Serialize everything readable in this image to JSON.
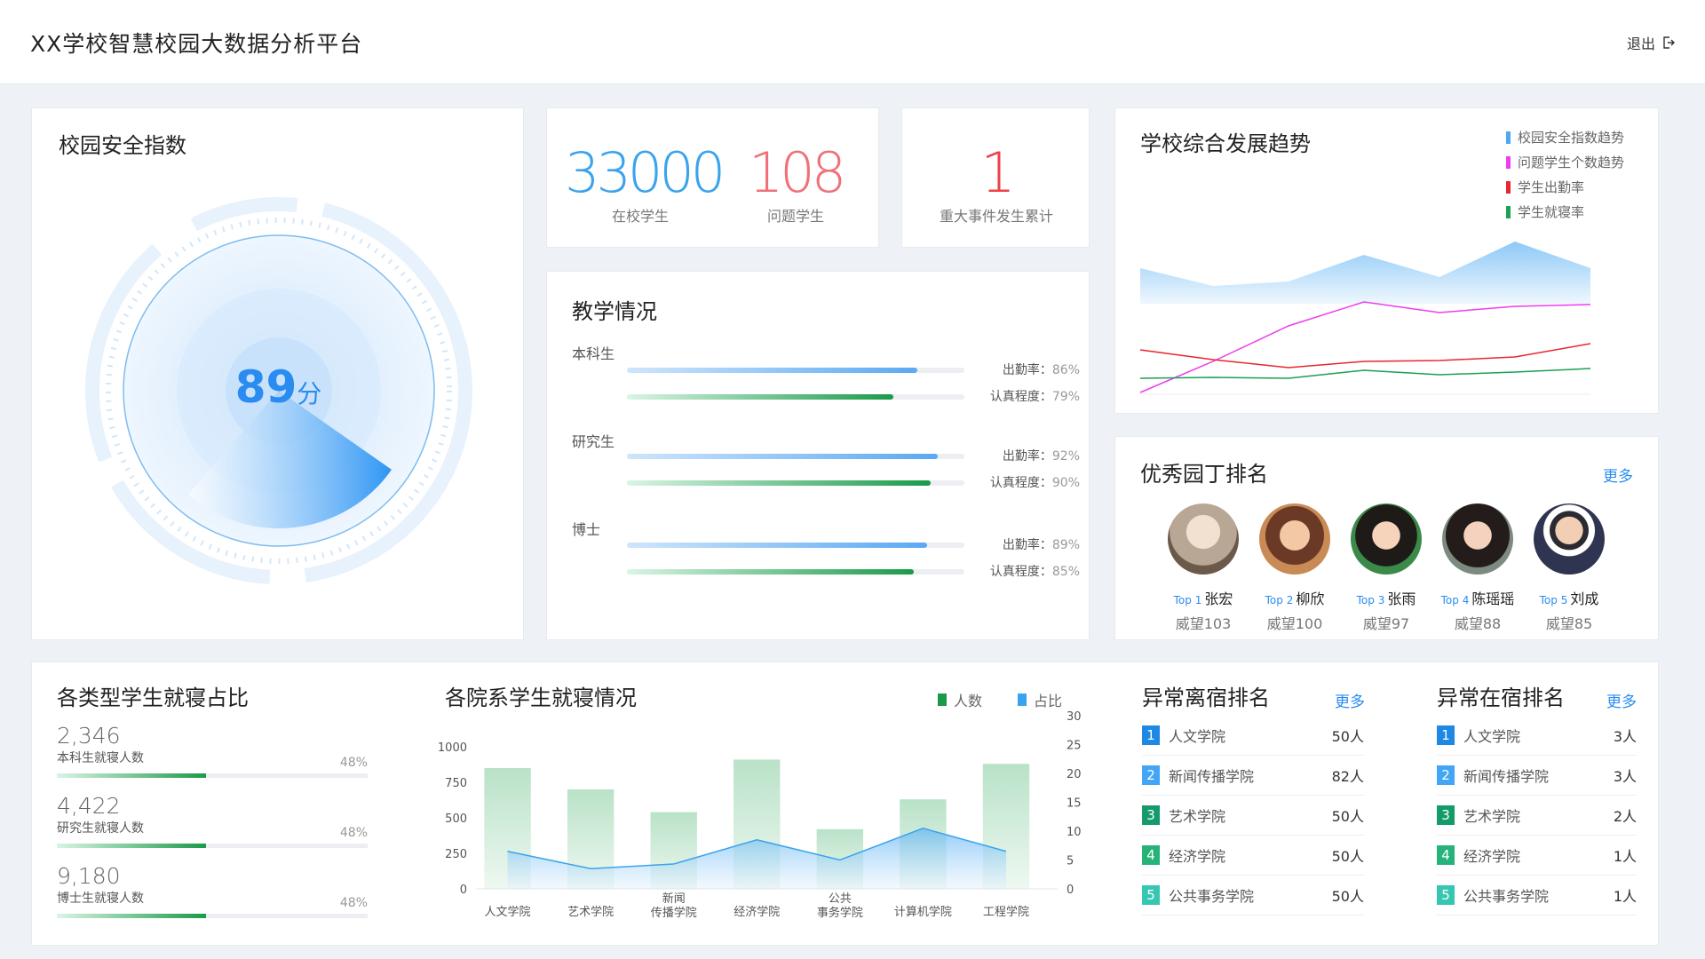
{
  "app": {
    "title": "XX学校智慧校园大数据分析平台",
    "logout_label": "退出"
  },
  "safety": {
    "title": "校园安全指数",
    "score": "89",
    "unit": "分",
    "value": 89
  },
  "stats": {
    "students": {
      "value": "33000",
      "label": "在校学生",
      "color": "#3aa3ee"
    },
    "problem": {
      "value": "108",
      "label": "问题学生",
      "color": "#f07078"
    },
    "events": {
      "value": "1",
      "label": "重大事件发生累计",
      "color": "#f0404a"
    }
  },
  "teaching": {
    "title": "教学情况",
    "groups": [
      {
        "name": "本科生",
        "attendance_label": "出勤率：",
        "attendance": "86%",
        "attendance_value": 0.86,
        "focus_label": "认真程度：",
        "focus": "79%",
        "focus_value": 0.79
      },
      {
        "name": "研究生",
        "attendance_label": "出勤率：",
        "attendance": "92%",
        "attendance_value": 0.92,
        "focus_label": "认真程度：",
        "focus": "90%",
        "focus_value": 0.9
      },
      {
        "name": "博士",
        "attendance_label": "出勤率：",
        "attendance": "89%",
        "attendance_value": 0.89,
        "focus_label": "认真程度：",
        "focus": "85%",
        "focus_value": 0.85
      }
    ]
  },
  "trend": {
    "title": "学校综合发展趋势",
    "legend": [
      {
        "name": "校园安全指数趋势",
        "color": "#4aa8f5"
      },
      {
        "name": "问题学生个数趋势",
        "color": "#ee3cf0"
      },
      {
        "name": "学生出勤率",
        "color": "#e8262f"
      },
      {
        "name": "学生就寝率",
        "color": "#1aa152"
      }
    ]
  },
  "ranking": {
    "title": "优秀园丁排名",
    "more_label": "更多",
    "teachers": [
      {
        "top": "Top 1",
        "name": "张宏",
        "score": "威望103"
      },
      {
        "top": "Top 2",
        "name": "柳欣",
        "score": "威望100"
      },
      {
        "top": "Top 3",
        "name": "张雨",
        "score": "威望97"
      },
      {
        "top": "Top 4",
        "name": "陈瑶瑶",
        "score": "威望88"
      },
      {
        "top": "Top 5",
        "name": "刘成",
        "score": "威望85"
      }
    ]
  },
  "sleep_ratio": {
    "title": "各类型学生就寝占比",
    "items": [
      {
        "value": "2,346",
        "label": "本科生就寝人数",
        "pct": "48%",
        "fill": 0.48
      },
      {
        "value": "4,422",
        "label": "研究生就寝人数",
        "pct": "48%",
        "fill": 0.48
      },
      {
        "value": "9,180",
        "label": "博士生就寝人数",
        "pct": "48%",
        "fill": 0.48
      }
    ]
  },
  "chart_data": {
    "type": "bar",
    "title": "各院系学生就寝情况",
    "categories": [
      "人文学院",
      "艺术学院",
      "新闻传播学院",
      "经济学院",
      "公共事务学院",
      "计算机学院",
      "工程学院"
    ],
    "category_lines": [
      [
        "人文学院"
      ],
      [
        "艺术学院"
      ],
      [
        "新闻",
        "传播学院"
      ],
      [
        "经济学院"
      ],
      [
        "公共",
        "事务学院"
      ],
      [
        "计算机学院"
      ],
      [
        "工程学院"
      ]
    ],
    "series": [
      {
        "name": "人数",
        "type": "bar",
        "axis": "left",
        "color": "#1a9a49",
        "values": [
          850,
          700,
          540,
          910,
          420,
          630,
          880
        ]
      },
      {
        "name": "占比",
        "type": "area",
        "axis": "right",
        "color": "#3aa3ee",
        "values": [
          6.5,
          3.5,
          4.3,
          8.5,
          5.0,
          10.5,
          6.5
        ]
      }
    ],
    "y_left": {
      "ticks": [
        "0",
        "250",
        "500",
        "750",
        "1000"
      ],
      "range": [
        0,
        1000
      ]
    },
    "y_right": {
      "ticks": [
        "0",
        "5",
        "10",
        "15",
        "20",
        "25",
        "30"
      ],
      "range": [
        0,
        30
      ]
    }
  },
  "away_list": {
    "title": "异常离宿排名",
    "more_label": "更多",
    "rows": [
      {
        "rank": "1",
        "name": "人文学院",
        "value": "50人",
        "color": "#1e88e5"
      },
      {
        "rank": "2",
        "name": "新闻传播学院",
        "value": "82人",
        "color": "#42a5f5"
      },
      {
        "rank": "3",
        "name": "艺术学院",
        "value": "50人",
        "color": "#159b6a"
      },
      {
        "rank": "4",
        "name": "经济学院",
        "value": "50人",
        "color": "#26b37a"
      },
      {
        "rank": "5",
        "name": "公共事务学院",
        "value": "50人",
        "color": "#36c7b2"
      }
    ]
  },
  "stay_list": {
    "title": "异常在宿排名",
    "more_label": "更多",
    "rows": [
      {
        "rank": "1",
        "name": "人文学院",
        "value": "3人",
        "color": "#1e88e5"
      },
      {
        "rank": "2",
        "name": "新闻传播学院",
        "value": "3人",
        "color": "#42a5f5"
      },
      {
        "rank": "3",
        "name": "艺术学院",
        "value": "2人",
        "color": "#159b6a"
      },
      {
        "rank": "4",
        "name": "经济学院",
        "value": "1人",
        "color": "#26b37a"
      },
      {
        "rank": "5",
        "name": "公共事务学院",
        "value": "1人",
        "color": "#36c7b2"
      }
    ]
  }
}
